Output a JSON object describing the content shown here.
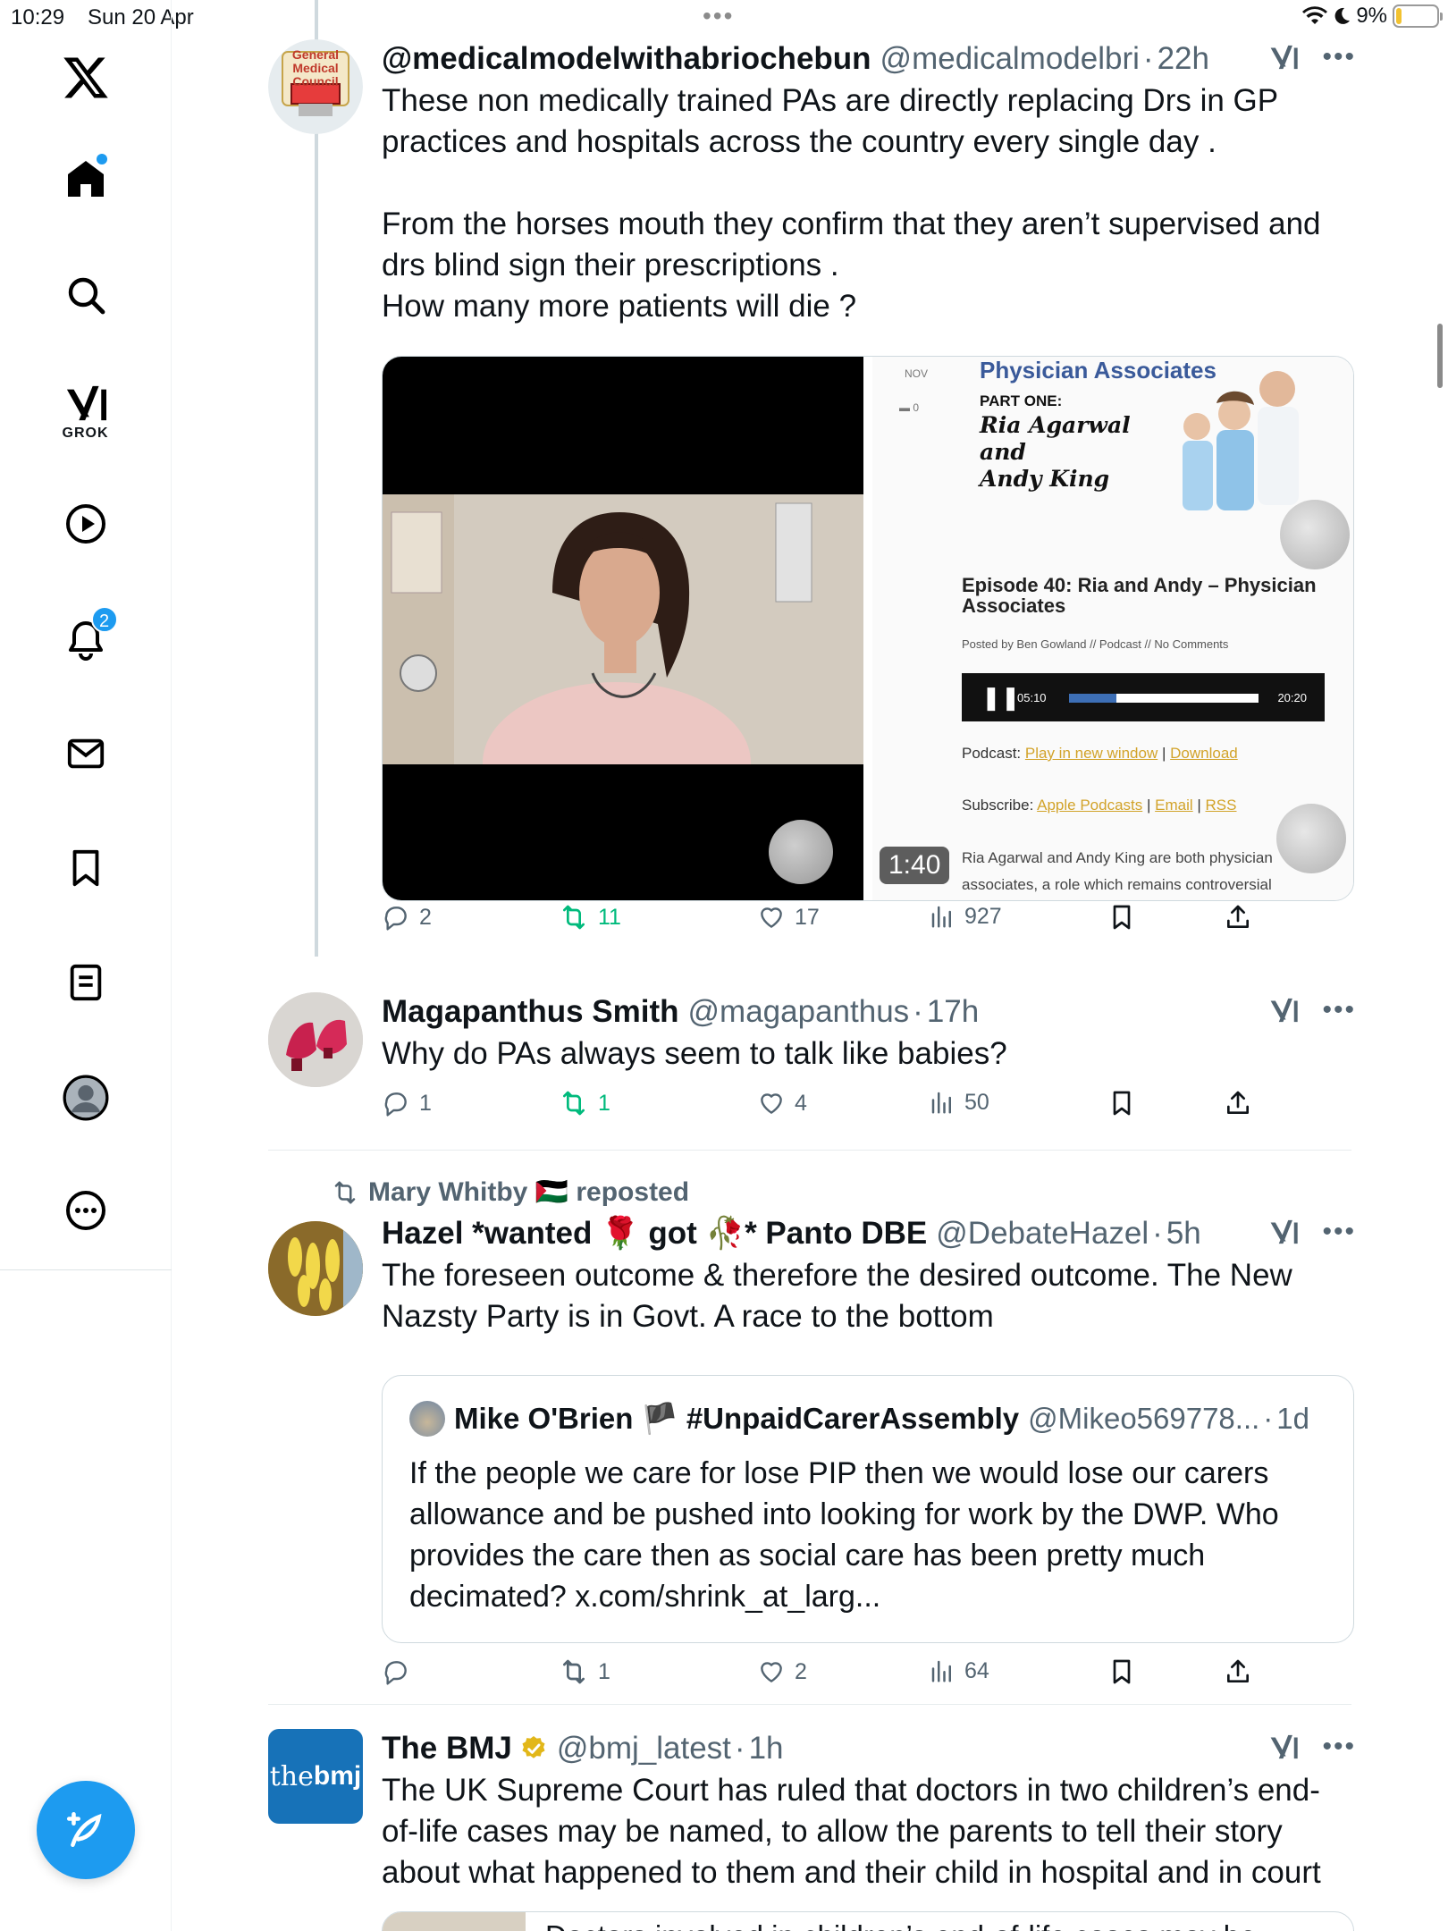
{
  "status": {
    "time": "10:29",
    "date": "Sun 20 Apr",
    "battery": "9%"
  },
  "sidebar": {
    "grok_label": "GROK",
    "notifications_count": "2"
  },
  "tweets": [
    {
      "name": "@medicalmodelwithabriochebun",
      "handle": "@medicalmodelbri",
      "sep": "·",
      "time": "22h",
      "text": "These non medically trained PAs are directly replacing Drs in GP practices and hospitals across the country every single day .\n\nFrom the horses mouth they confirm that they aren’t supervised and drs  blind sign their prescriptions .\nHow many more patients will die ?",
      "avatar_text": "General Medical Council",
      "media": {
        "duration": "1:40",
        "podcast": {
          "title": "Physician Associates",
          "part": "PART ONE:",
          "names_line1": "Ria Agarwal",
          "names_line2": "and",
          "names_line3": "Andy King",
          "month": "NOV",
          "comments": "0",
          "episode": "Episode 40: Ria and Andy – Physician Associates",
          "posted": "Posted by Ben Gowland // Podcast // No Comments",
          "time_current": "05:10",
          "time_total": "20:20",
          "progress": 0.25,
          "podcast_label": "Podcast:",
          "play_link": "Play in new window",
          "download_link": "Download",
          "subscribe_label": "Subscribe:",
          "apple_link": "Apple Podcasts",
          "email_link": "Email",
          "rss_link": "RSS",
          "desc": "Ria Agarwal and Andy King are both physician associates, a role which remains controversial"
        }
      },
      "stats": {
        "replies": "2",
        "reposts": "11",
        "likes": "17",
        "views": "927"
      }
    },
    {
      "name": "Magapanthus Smith",
      "handle": "@magapanthus",
      "sep": "·",
      "time": "17h",
      "text": "Why do PAs always seem to talk like babies?",
      "stats": {
        "replies": "1",
        "reposts": "1",
        "likes": "4",
        "views": "50"
      }
    },
    {
      "repost_by": "Mary Whitby 🇵🇸 reposted",
      "name": "Hazel *wanted 🌹 got 🥀* Panto DBE",
      "handle": "@DebateHazel",
      "sep": "·",
      "time": "5h",
      "text": "The foreseen outcome & therefore the desired outcome.  The New Nazsty Party is in Govt. A race to the bottom",
      "quote": {
        "name": "Mike O'Brien 🏴 #UnpaidCarerAssembly",
        "handle": "@Mikeo569778...",
        "sep": "·",
        "time": "1d",
        "text": "If the people we care for lose PIP then we would lose our carers allowance and be pushed into looking for work by the DWP. Who provides the care then as social care has been pretty much decimated? x.com/shrink_at_larg..."
      },
      "stats": {
        "replies": "",
        "reposts": "1",
        "likes": "2",
        "views": "64"
      }
    },
    {
      "name": "The BMJ",
      "handle": "@bmj_latest",
      "sep": "·",
      "time": "1h",
      "avatar_text_light": "the",
      "avatar_text_bold": "bmj",
      "text": "The UK Supreme Court has ruled that doctors in two children’s end-of-life cases may be named, to allow the parents to tell their story about what happened to them and their child in hospital and in court",
      "link_preview_text": "Doctors involved in children’s end-of-life cases may be"
    }
  ],
  "colors": {
    "accent": "#1d9bf0",
    "repost_green": "#00ba7c",
    "secondary_text": "#536471",
    "border": "#cfd9de"
  }
}
